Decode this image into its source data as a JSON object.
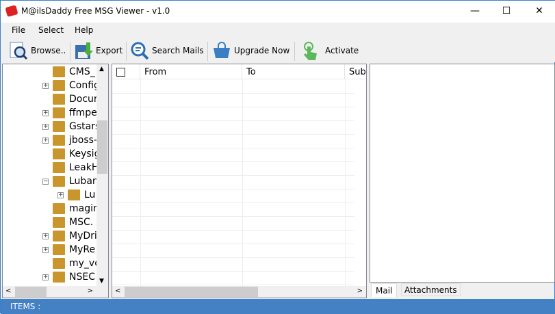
{
  "window": {
    "title": "M@ilsDaddy Free MSG Viewer - v1.0",
    "minimize": "—",
    "maximize": "☐",
    "close": "✕"
  },
  "menu": [
    "File",
    "Select",
    "Help"
  ],
  "toolbar": [
    {
      "label": "Browse..",
      "icon": "browse-icon"
    },
    {
      "label": "Export",
      "icon": "export-icon"
    },
    {
      "label": "Search Mails",
      "icon": "search-icon"
    },
    {
      "label": "Upgrade Now",
      "icon": "cart-icon"
    },
    {
      "label": "Activate",
      "icon": "activate-icon"
    }
  ],
  "tree": [
    {
      "label": "CMS_",
      "exp": ""
    },
    {
      "label": "Config",
      "exp": "+"
    },
    {
      "label": "Docur",
      "exp": ""
    },
    {
      "label": "ffmpeg",
      "exp": "+"
    },
    {
      "label": "Gstars",
      "exp": "+"
    },
    {
      "label": "jboss-",
      "exp": "+"
    },
    {
      "label": "Keysig",
      "exp": ""
    },
    {
      "label": "LeakH",
      "exp": ""
    },
    {
      "label": "Luban",
      "exp": "−"
    },
    {
      "label": "Lu",
      "exp": "+",
      "child": true
    },
    {
      "label": "magin",
      "exp": ""
    },
    {
      "label": "MSC.",
      "exp": ""
    },
    {
      "label": "MyDri",
      "exp": "+"
    },
    {
      "label": "MyRe",
      "exp": "+"
    },
    {
      "label": "my_vc",
      "exp": ""
    },
    {
      "label": "NSEC",
      "exp": "+"
    }
  ],
  "grid": {
    "columns": [
      "From",
      "To",
      "Sub"
    ]
  },
  "preview": {
    "tabs": [
      "Mail",
      "Attachments"
    ]
  },
  "status": {
    "items_label": "ITEMS :"
  }
}
